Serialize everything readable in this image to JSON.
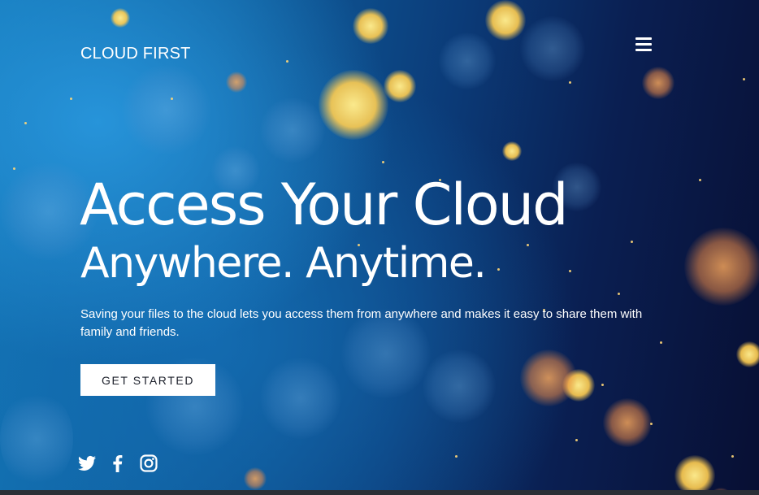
{
  "brand": {
    "name": "CLOUD FIRST"
  },
  "nav": {
    "menu_icon": "hamburger-menu-icon"
  },
  "hero": {
    "headline_line1": "Access Your Cloud",
    "headline_line2": "Anywhere. Anytime.",
    "description": "Saving your files to the cloud lets you access them from anywhere and makes it easy to share them with family and friends.",
    "cta_label": "GET STARTED"
  },
  "social": [
    {
      "icon": "twitter-icon"
    },
    {
      "icon": "facebook-icon"
    },
    {
      "icon": "instagram-icon"
    }
  ],
  "colors": {
    "background_light": "#1378b8",
    "background_dark": "#080f33",
    "cta_background": "#ffffff",
    "cta_text": "#1b1f2a",
    "bokeh_gold": "#ffd75a"
  }
}
